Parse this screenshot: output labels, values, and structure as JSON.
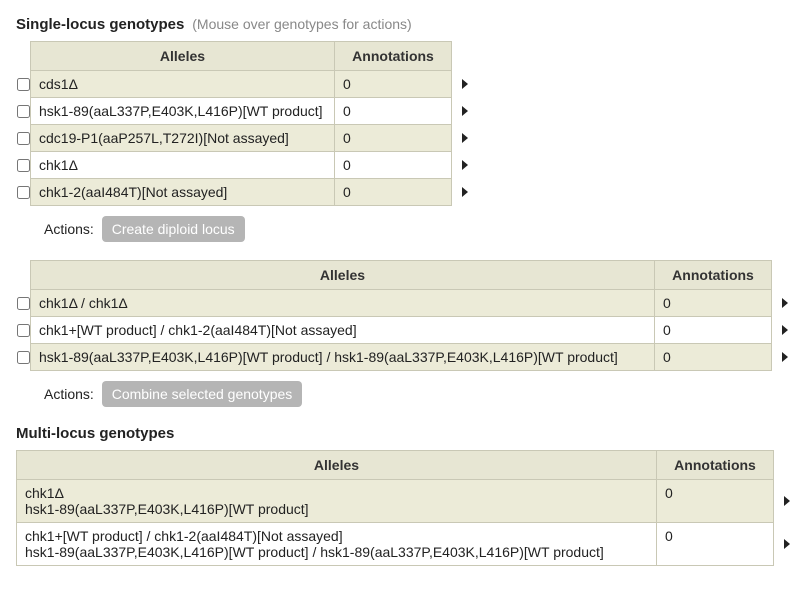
{
  "sections": {
    "single": {
      "title": "Single-locus genotypes",
      "hint": "(Mouse over genotypes for actions)",
      "headers": {
        "alleles": "Alleles",
        "annotations": "Annotations"
      },
      "rows": [
        {
          "allele": "cds1Δ",
          "annotations": "0"
        },
        {
          "allele": "hsk1-89(aaL337P,E403K,L416P)[WT product]",
          "annotations": "0"
        },
        {
          "allele": "cdc19-P1(aaP257L,T272I)[Not assayed]",
          "annotations": "0"
        },
        {
          "allele": "chk1Δ",
          "annotations": "0"
        },
        {
          "allele": "chk1-2(aaI484T)[Not assayed]",
          "annotations": "0"
        }
      ],
      "actions_label": "Actions:",
      "actions_button": "Create diploid locus"
    },
    "diploid": {
      "headers": {
        "alleles": "Alleles",
        "annotations": "Annotations"
      },
      "rows": [
        {
          "allele": "chk1Δ / chk1Δ",
          "annotations": "0"
        },
        {
          "allele": "chk1+[WT product] / chk1-2(aaI484T)[Not assayed]",
          "annotations": "0"
        },
        {
          "allele": "hsk1-89(aaL337P,E403K,L416P)[WT product] / hsk1-89(aaL337P,E403K,L416P)[WT product]",
          "annotations": "0"
        }
      ],
      "actions_label": "Actions:",
      "actions_button": "Combine selected genotypes"
    },
    "multi": {
      "title": "Multi-locus genotypes",
      "headers": {
        "alleles": "Alleles",
        "annotations": "Annotations"
      },
      "rows": [
        {
          "allele_line1": "chk1Δ",
          "allele_line2": "hsk1-89(aaL337P,E403K,L416P)[WT product]",
          "annotations": "0"
        },
        {
          "allele_line1": "chk1+[WT product] / chk1-2(aaI484T)[Not assayed]",
          "allele_line2": "hsk1-89(aaL337P,E403K,L416P)[WT product] / hsk1-89(aaL337P,E403K,L416P)[WT product]",
          "annotations": "0"
        }
      ]
    }
  }
}
